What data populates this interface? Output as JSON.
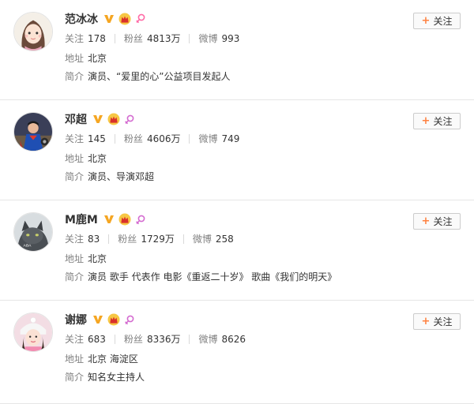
{
  "users": [
    {
      "name": "范冰冰",
      "stats": [
        {
          "label": "关注",
          "value": "178"
        },
        {
          "label": "粉丝",
          "value": "4813万"
        },
        {
          "label": "微博",
          "value": "993"
        }
      ],
      "location_label": "地址",
      "location": "北京",
      "bio_label": "简介",
      "bio": "演员、“爱里的心”公益项目发起人",
      "follow_label": "关注",
      "avatar": "cartoon-girl",
      "gender": "female"
    },
    {
      "name": "邓超",
      "stats": [
        {
          "label": "关注",
          "value": "145"
        },
        {
          "label": "粉丝",
          "value": "4606万"
        },
        {
          "label": "微博",
          "value": "749"
        }
      ],
      "location_label": "地址",
      "location": "北京",
      "bio_label": "简介",
      "bio": "演员、导演邓超",
      "follow_label": "关注",
      "avatar": "superman",
      "gender": "male"
    },
    {
      "name": "M鹿M",
      "stats": [
        {
          "label": "关注",
          "value": "83"
        },
        {
          "label": "粉丝",
          "value": "1729万"
        },
        {
          "label": "微博",
          "value": "258"
        }
      ],
      "location_label": "地址",
      "location": "北京",
      "bio_label": "简介",
      "bio": "演员 歌手 代表作 电影《重返二十岁》 歌曲《我们的明天》",
      "follow_label": "关注",
      "avatar": "cat",
      "gender": "male"
    },
    {
      "name": "谢娜",
      "stats": [
        {
          "label": "关注",
          "value": "683"
        },
        {
          "label": "粉丝",
          "value": "8336万"
        },
        {
          "label": "微博",
          "value": "8626"
        }
      ],
      "location_label": "地址",
      "location": "北京 海淀区",
      "bio_label": "简介",
      "bio": "知名女主持人",
      "follow_label": "关注",
      "avatar": "girl-hat",
      "gender": "male"
    }
  ],
  "colors": {
    "verified": "#f5a623",
    "crown": "#e8a000",
    "female": "#ff6aa6",
    "male": "#d46bd0",
    "plus": "#ff8140"
  },
  "icons": [
    "verified-v-icon",
    "crown-icon",
    "gender-female-icon",
    "gender-male-icon",
    "plus-icon"
  ]
}
